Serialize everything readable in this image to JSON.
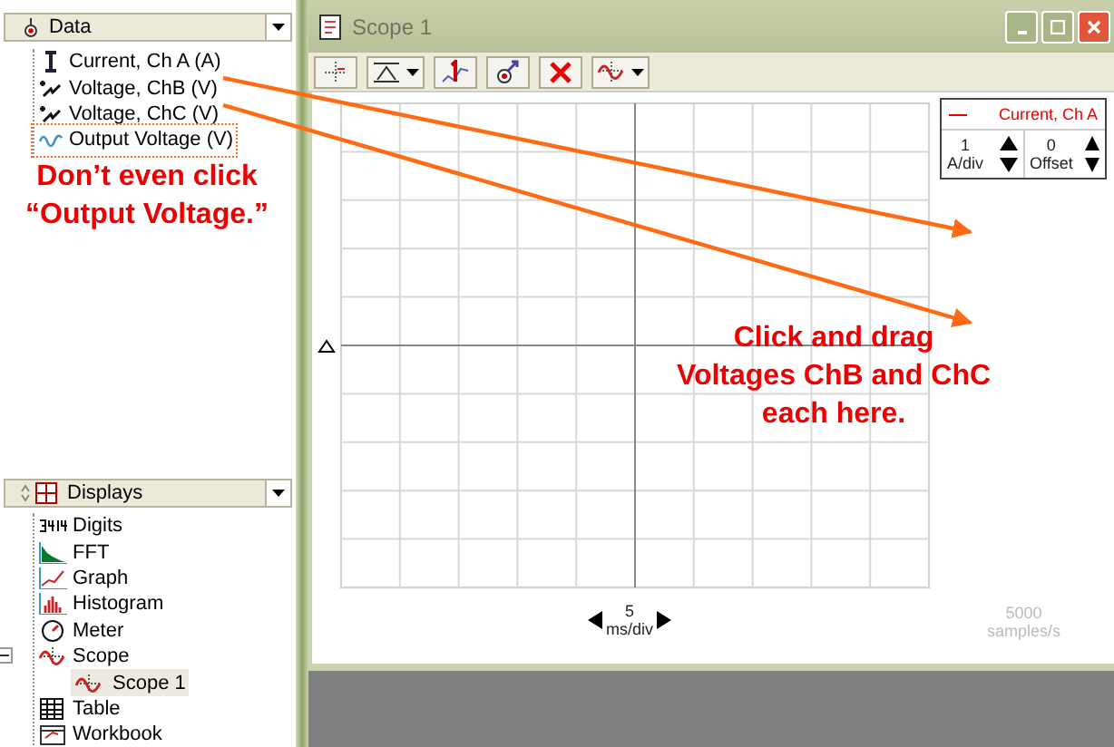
{
  "data_panel": {
    "title": "Data",
    "items": [
      {
        "label": "Current, Ch A (A)",
        "kind": "current"
      },
      {
        "label": "Voltage, ChB (V)",
        "kind": "voltage"
      },
      {
        "label": "Voltage, ChC (V)",
        "kind": "voltage"
      },
      {
        "label": "Output Voltage (V)",
        "kind": "output"
      }
    ]
  },
  "displays_panel": {
    "title": "Displays",
    "items": [
      {
        "label": "Digits",
        "kind": "digits",
        "selected": false
      },
      {
        "label": "FFT",
        "kind": "fft",
        "selected": false
      },
      {
        "label": "Graph",
        "kind": "graph",
        "selected": false
      },
      {
        "label": "Histogram",
        "kind": "histogram",
        "selected": false
      },
      {
        "label": "Meter",
        "kind": "meter",
        "selected": false
      },
      {
        "label": "Scope",
        "kind": "scope",
        "selected": false,
        "expanded": true,
        "children": [
          {
            "label": "Scope 1",
            "selected": true
          }
        ]
      },
      {
        "label": "Table",
        "kind": "table",
        "selected": false
      },
      {
        "label": "Workbook",
        "kind": "workbook",
        "selected": false
      }
    ]
  },
  "scope_window": {
    "title": "Scope 1",
    "legend": {
      "label": "Current, Ch A"
    },
    "y_scale": {
      "value": "1",
      "unit": "A/div"
    },
    "offset": {
      "value": "0",
      "unit": "Offset"
    },
    "x_scale": {
      "value": "5",
      "unit": "ms/div"
    },
    "sample_rate": {
      "value": "5000",
      "unit": "samples/s"
    }
  },
  "annotations": [
    {
      "kind": "warning",
      "text": "Don’t even click “Output Voltage.”"
    },
    {
      "kind": "instruction",
      "text": "Click and drag Voltages ChB and ChC each here."
    }
  ]
}
